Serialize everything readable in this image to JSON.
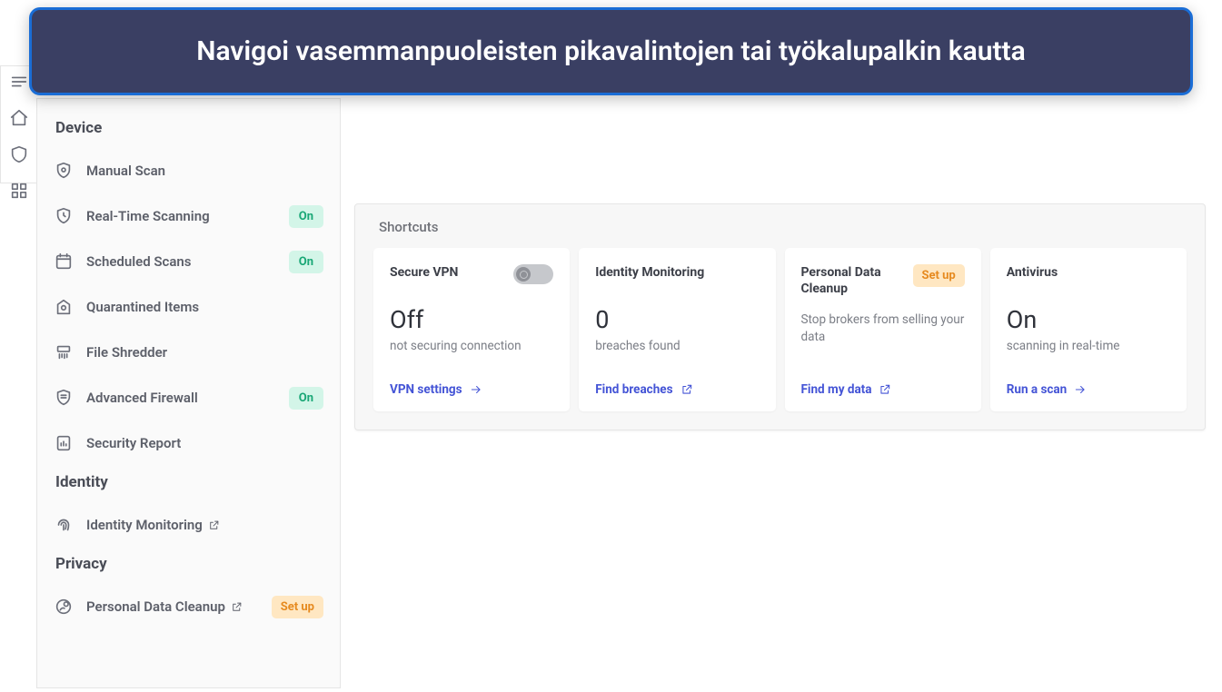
{
  "banner": {
    "text": "Navigoi vasemmanpuoleisten pikavalintojen tai työkalupalkin kautta"
  },
  "sidebar": {
    "sections": [
      {
        "title": "Device",
        "items": [
          {
            "label": "Manual Scan",
            "icon": "shield-scan",
            "badge": null,
            "external": false
          },
          {
            "label": "Real-Time Scanning",
            "icon": "shield-clock",
            "badge": "On",
            "external": false
          },
          {
            "label": "Scheduled Scans",
            "icon": "calendar",
            "badge": "On",
            "external": false
          },
          {
            "label": "Quarantined Items",
            "icon": "quarantine",
            "badge": null,
            "external": false
          },
          {
            "label": "File Shredder",
            "icon": "shredder",
            "badge": null,
            "external": false
          },
          {
            "label": "Advanced Firewall",
            "icon": "firewall-shield",
            "badge": "On",
            "external": false
          },
          {
            "label": "Security Report",
            "icon": "report",
            "badge": null,
            "external": false
          }
        ]
      },
      {
        "title": "Identity",
        "items": [
          {
            "label": "Identity Monitoring",
            "icon": "fingerprint",
            "badge": null,
            "external": true
          }
        ]
      },
      {
        "title": "Privacy",
        "items": [
          {
            "label": "Personal Data Cleanup",
            "icon": "data-cleanup",
            "badge": "Set up",
            "external": true
          }
        ]
      }
    ]
  },
  "shortcuts": {
    "title": "Shortcuts",
    "cards": [
      {
        "title": "Secure VPN",
        "value": "Off",
        "subtitle": "not securing connection",
        "link_label": "VPN settings",
        "link_icon": "arrow",
        "toggle": true,
        "badge": null
      },
      {
        "title": "Identity Monitoring",
        "value": "0",
        "subtitle": "breaches found",
        "link_label": "Find breaches",
        "link_icon": "external",
        "toggle": false,
        "badge": null
      },
      {
        "title": "Personal Data Cleanup",
        "value": "",
        "subtitle": "Stop brokers from selling your data",
        "link_label": "Find my data",
        "link_icon": "external",
        "toggle": false,
        "badge": "Set up"
      },
      {
        "title": "Antivirus",
        "value": "On",
        "subtitle": "scanning in real-time",
        "link_label": "Run a scan",
        "link_icon": "arrow",
        "toggle": false,
        "badge": null
      }
    ]
  }
}
